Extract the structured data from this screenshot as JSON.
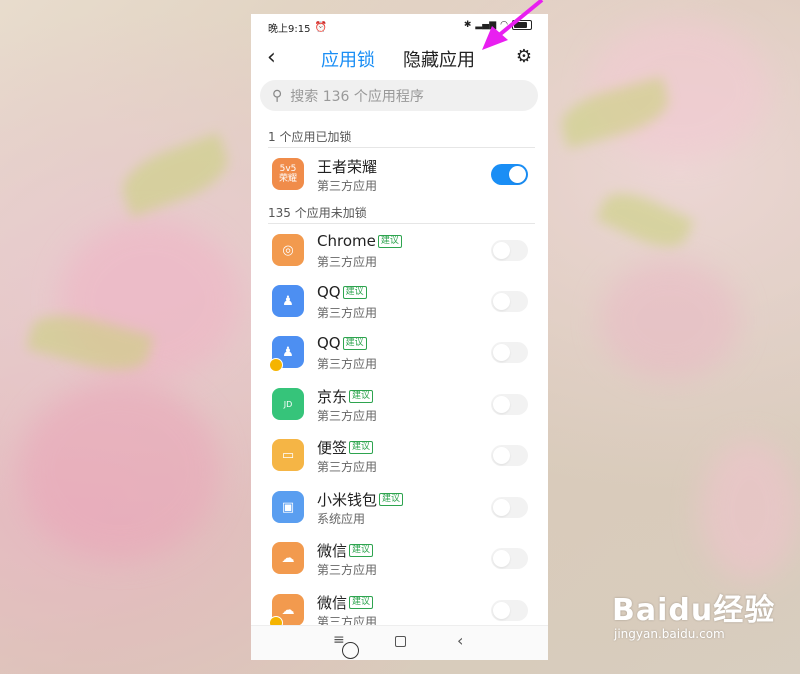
{
  "status_bar": {
    "time": "晚上9:15",
    "alarm_icon": "alarm-icon"
  },
  "header": {
    "back_icon": "back-icon",
    "tab_applock": "应用锁",
    "tab_hidden": "隐藏应用",
    "settings_icon": "gear-icon"
  },
  "search": {
    "placeholder": "搜索 136 个应用程序"
  },
  "locked_section": {
    "title": "1 个应用已加锁",
    "apps": [
      {
        "name": "王者荣耀",
        "type": "第三方应用",
        "locked": true,
        "icon_color": "#f08c4a"
      }
    ]
  },
  "unlocked_section": {
    "title": "135 个应用未加锁",
    "apps": [
      {
        "name": "Chrome",
        "tag": "建议",
        "type": "第三方应用",
        "locked": false,
        "icon_color": "#f29a4e"
      },
      {
        "name": "QQ",
        "tag": "建议",
        "type": "第三方应用",
        "locked": false,
        "icon_color": "#4d8ff2"
      },
      {
        "name": "QQ",
        "tag": "建议",
        "type": "第三方应用",
        "locked": false,
        "icon_color": "#4d8ff2",
        "dual_badge": true
      },
      {
        "name": "京东",
        "tag": "建议",
        "type": "第三方应用",
        "locked": false,
        "icon_color": "#36c47a"
      },
      {
        "name": "便签",
        "tag": "建议",
        "type": "第三方应用",
        "locked": false,
        "icon_color": "#f5b545"
      },
      {
        "name": "小米钱包",
        "tag": "建议",
        "type": "系统应用",
        "locked": false,
        "icon_color": "#5a9ef0"
      },
      {
        "name": "微信",
        "tag": "建议",
        "type": "第三方应用",
        "locked": false,
        "icon_color": "#f29a4e"
      },
      {
        "name": "微信",
        "tag": "建议",
        "type": "第三方应用",
        "locked": false,
        "icon_color": "#f29a4e",
        "dual_badge": true
      }
    ]
  },
  "colors": {
    "accent": "#1a8ef5",
    "tag_green": "#2ea44f",
    "arrow": "#e81ff0"
  },
  "watermark": {
    "logo": "Baidu经验",
    "url": "jingyan.baidu.com"
  }
}
